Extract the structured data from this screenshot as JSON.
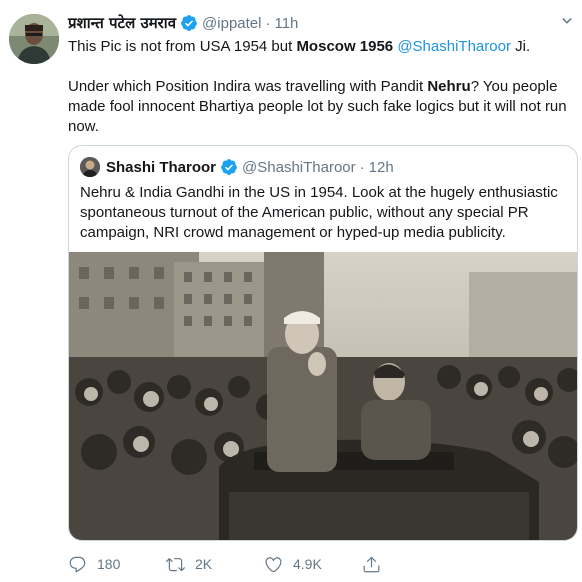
{
  "tweet": {
    "author_name": "प्रशान्त पटेल उमराव",
    "author_handle": "@ippatel",
    "separator": "·",
    "time": "11h",
    "line1_a": "This Pic is not from USA 1954 but ",
    "line1_bold": "Moscow 1956",
    "line1_space": " ",
    "line1_mention": "@ShashiTharoor",
    "line1_b": " Ji.",
    "para2_a": "Under which Position Indira was travelling with Pandit ",
    "para2_bold": "Nehru",
    "para2_b": "? You people made fool innocent Bhartiya people lot by such fake logics but it will not run now."
  },
  "quote": {
    "author_name": "Shashi Tharoor",
    "author_handle": "@ShashiTharoor",
    "separator": "·",
    "time": "12h",
    "text": "Nehru & India Gandhi in the US in 1954. Look at the hugely enthusiastic spontaneous turnout of the American public, without any special PR campaign, NRI crowd management or hyped-up media publicity."
  },
  "actions": {
    "reply_count": "180",
    "retweet_count": "2K",
    "like_count": "4.9K"
  },
  "icons": {
    "verified": "verified-badge-icon",
    "caret": "chevron-down-icon",
    "reply": "reply-icon",
    "retweet": "retweet-icon",
    "like": "heart-icon",
    "share": "share-icon"
  },
  "colors": {
    "link": "#1b95e0",
    "verified": "#1da1f2",
    "secondary_text": "#657786",
    "border": "#ccd6dd"
  }
}
